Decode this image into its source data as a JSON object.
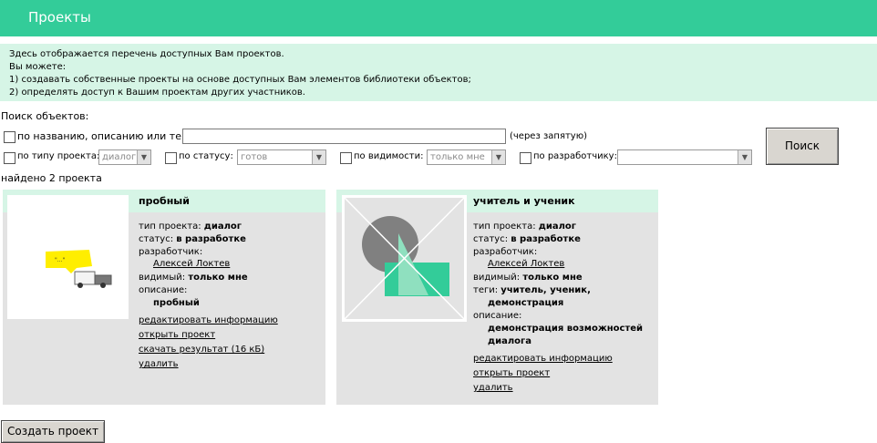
{
  "header": {
    "title": "Проекты"
  },
  "intro": {
    "lines": [
      "Здесь отображается перечень доступных Вам проектов.",
      "Вы можете:",
      "1) создавать собственные проекты на основе доступных Вам элементов библиотеки объектов;",
      "2) определять доступ к Вашим проектам других участников."
    ]
  },
  "search": {
    "heading": "Поиск объектов:",
    "by_text_label": "по названию, описанию или тегам:",
    "text_value": "",
    "text_hint": "(через запятую)",
    "by_type_label": "по типу проекта:",
    "type_value": "диалог",
    "by_status_label": "по статусу:",
    "status_value": "готов",
    "by_visibility_label": "по видимости:",
    "visibility_value": "только мне",
    "by_developer_label": "по разработчику:",
    "developer_value": "",
    "search_button": "Поиск"
  },
  "results_count": "найдено 2 проекта",
  "projects": [
    {
      "title": "пробный",
      "type_label": "тип проекта:",
      "type_value": "диалог",
      "status_label": "статус:",
      "status_value": "в разработке",
      "developer_label": "разработчик:",
      "developer_name": "Алексей Локтев",
      "visible_label": "видимый:",
      "visible_value": "только мне",
      "description_label": "описание:",
      "description_value": "пробный",
      "actions": [
        "редактировать информацию",
        "открыть проект",
        "скачать результат (16 кБ)",
        "удалить"
      ],
      "bubble_text": "\"...\""
    },
    {
      "title": "учитель и ученик",
      "type_label": "тип проекта:",
      "type_value": "диалог",
      "status_label": "статус:",
      "status_value": "в разработке",
      "developer_label": "разработчик:",
      "developer_name": "Алексей Локтев",
      "visible_label": "видимый:",
      "visible_value": "только мне",
      "tags_label": "теги:",
      "tags_line1": "учитель, ученик,",
      "tags_line2": "демонстрация",
      "description_label": "описание:",
      "description_line1": "демонстрация возможностей",
      "description_line2": "диалога",
      "actions": [
        "редактировать информацию",
        "открыть проект",
        "удалить"
      ]
    }
  ],
  "create_button": "Создать проект",
  "colors": {
    "accent": "#33cc99",
    "light_accent": "#d6f5e6",
    "card_bg": "#e3e3e3"
  }
}
